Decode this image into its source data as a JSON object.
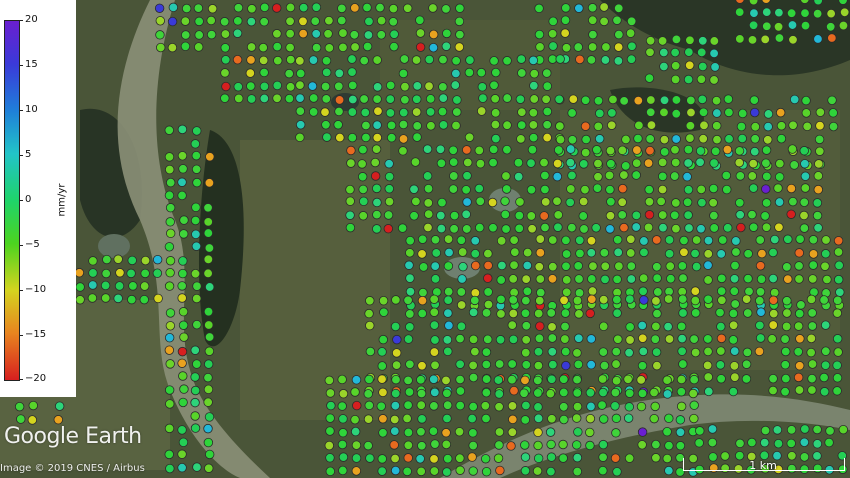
{
  "colorbar": {
    "unit": "mm/yr",
    "ticks": [
      "20",
      "15",
      "10",
      "5",
      "0",
      "−5",
      "−10",
      "−15",
      "−20"
    ],
    "range": [
      -20,
      20
    ],
    "colors": [
      "#6a1fd0",
      "#3a3ad8",
      "#1f7fd8",
      "#22c4c8",
      "#1fd46a",
      "#4cd41f",
      "#d4d41f",
      "#e8841f",
      "#d61f1f"
    ]
  },
  "watermark": "Google Earth",
  "attribution": "Image © 2019 CNES / Airbus",
  "scale_bar": {
    "label": "1 km"
  },
  "basemap": {
    "terrain_color": "#4a5538",
    "field_color": "#59623f",
    "forest_color": "#243020",
    "water_color": "#6f8070",
    "river_color": "#8b9078",
    "marker_outline": "#2b2b2b"
  }
}
